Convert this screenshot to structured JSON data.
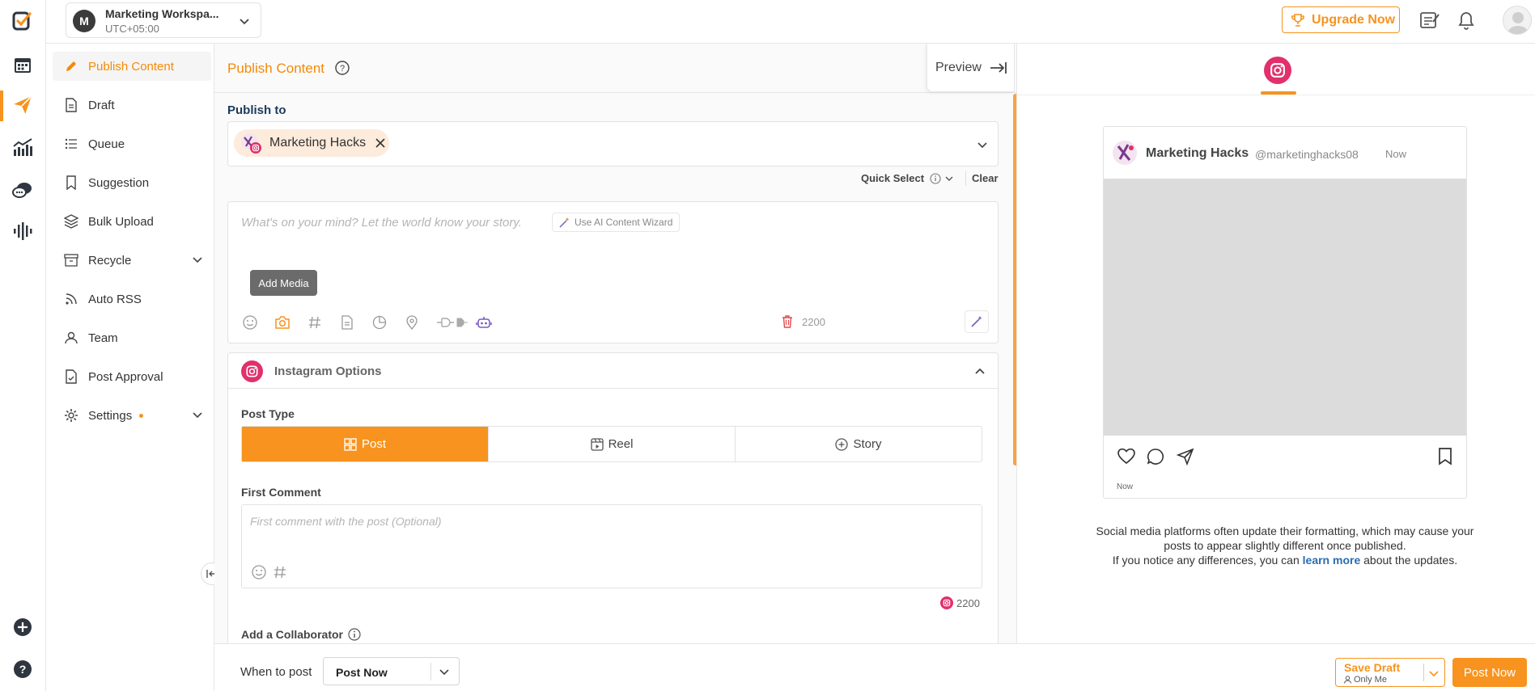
{
  "workspace": {
    "initial": "M",
    "name": "Marketing Workspa...",
    "timezone": "UTC+05:00"
  },
  "topbar": {
    "upgrade_label": "Upgrade Now"
  },
  "nav": {
    "items": [
      {
        "label": "Publish Content"
      },
      {
        "label": "Draft"
      },
      {
        "label": "Queue"
      },
      {
        "label": "Suggestion"
      },
      {
        "label": "Bulk Upload"
      },
      {
        "label": "Recycle"
      },
      {
        "label": "Auto RSS"
      },
      {
        "label": "Team"
      },
      {
        "label": "Post Approval"
      },
      {
        "label": "Settings"
      }
    ]
  },
  "main": {
    "title": "Publish Content",
    "preview_label": "Preview",
    "publish_to_label": "Publish to",
    "selected_account": "Marketing Hacks",
    "quick_select_label": "Quick Select",
    "clear_label": "Clear",
    "editor": {
      "placeholder": "What's on your mind? Let the world know your story.",
      "ai_wizard_label": "Use AI Content Wizard",
      "tooltip": "Add Media",
      "char_count": "2200"
    },
    "instagram": {
      "section_title": "Instagram Options",
      "post_type_label": "Post Type",
      "post_types": [
        "Post",
        "Reel",
        "Story"
      ],
      "selected_post_type": "Post",
      "first_comment_label": "First Comment",
      "first_comment_placeholder": "First comment with the post (Optional)",
      "comment_char_count": "2200",
      "collaborator_label": "Add a Collaborator"
    }
  },
  "preview": {
    "account_name": "Marketing Hacks",
    "handle": "@marketinghacks08",
    "time": "Now",
    "footer_time": "Now",
    "note_line1": "Social media platforms often update their formatting, which may cause your",
    "note_line2": "posts to appear slightly different once published.",
    "note_line3_pre": "If you notice any differences, you can",
    "note_link": "learn more",
    "note_line3_post": "about the updates."
  },
  "bottom": {
    "when_label": "When to post",
    "when_value": "Post Now",
    "save_draft_label": "Save Draft",
    "save_draft_sub": "Only Me",
    "post_now_label": "Post Now"
  },
  "colors": {
    "accent": "#f7931e",
    "instagram": "#e1306c",
    "link": "#2b6cb0"
  }
}
